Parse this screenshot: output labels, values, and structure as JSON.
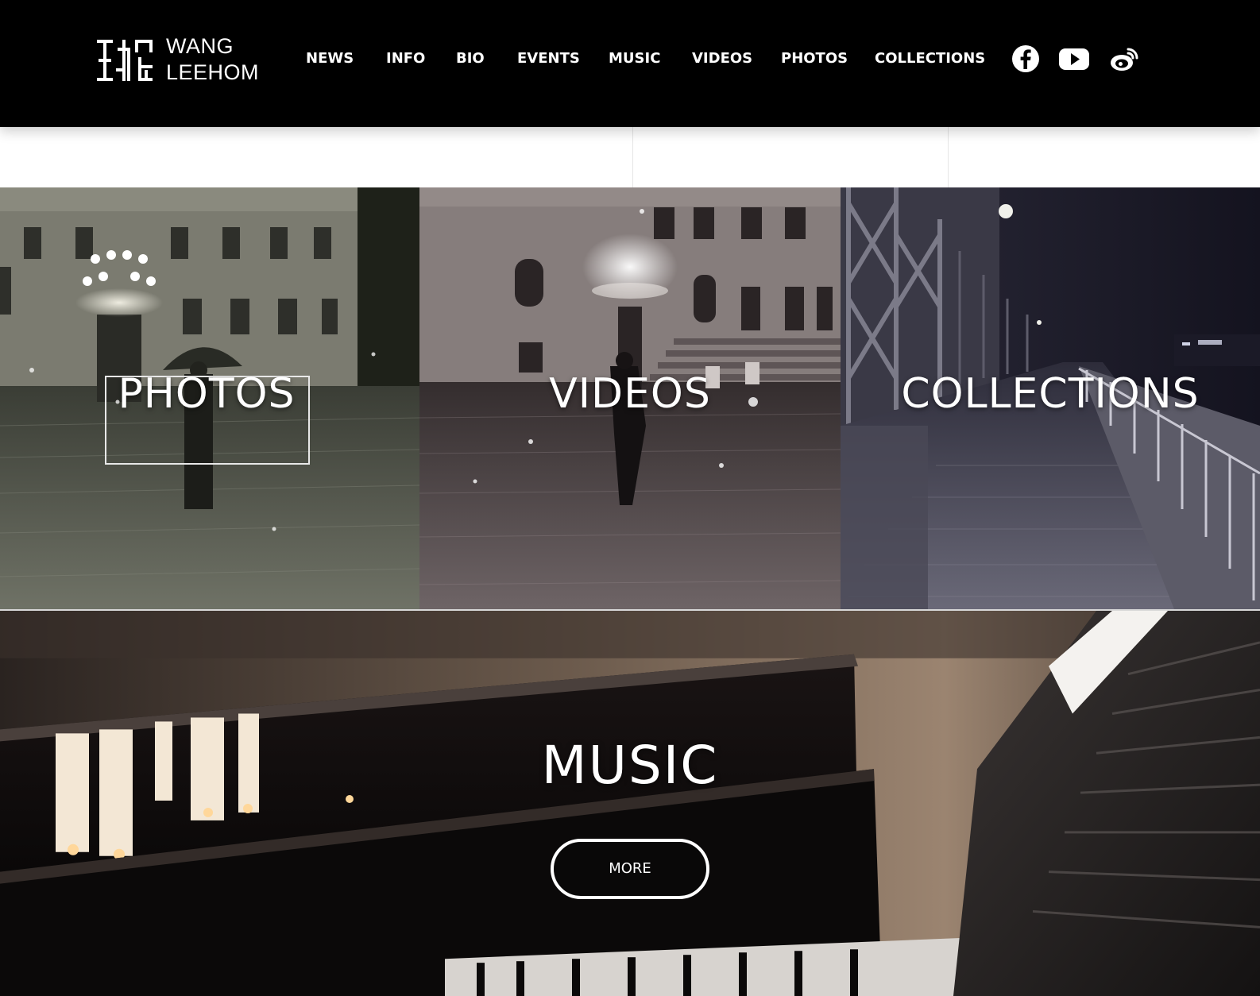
{
  "header": {
    "logo": {
      "line1": "WANG",
      "line2": "LEEHOM"
    },
    "nav": [
      {
        "label": "NEWS"
      },
      {
        "label": "INFO"
      },
      {
        "label": "BIO"
      },
      {
        "label": "EVENTS"
      },
      {
        "label": "MUSIC"
      },
      {
        "label": "VIDEOS"
      },
      {
        "label": "PHOTOS"
      },
      {
        "label": "COLLECTIONS"
      }
    ],
    "social": [
      {
        "icon": "facebook-icon"
      },
      {
        "icon": "youtube-icon"
      },
      {
        "icon": "weibo-icon"
      }
    ]
  },
  "tiles": [
    {
      "label": "PHOTOS",
      "icon": "photos-tile-image"
    },
    {
      "label": "VIDEOS",
      "icon": "videos-tile-image"
    },
    {
      "label": "COLLECTIONS",
      "icon": "collections-tile-image"
    }
  ],
  "music": {
    "title": "MUSIC",
    "button": "MORE"
  },
  "colors": {
    "header_bg": "#000000",
    "text": "#ffffff"
  }
}
